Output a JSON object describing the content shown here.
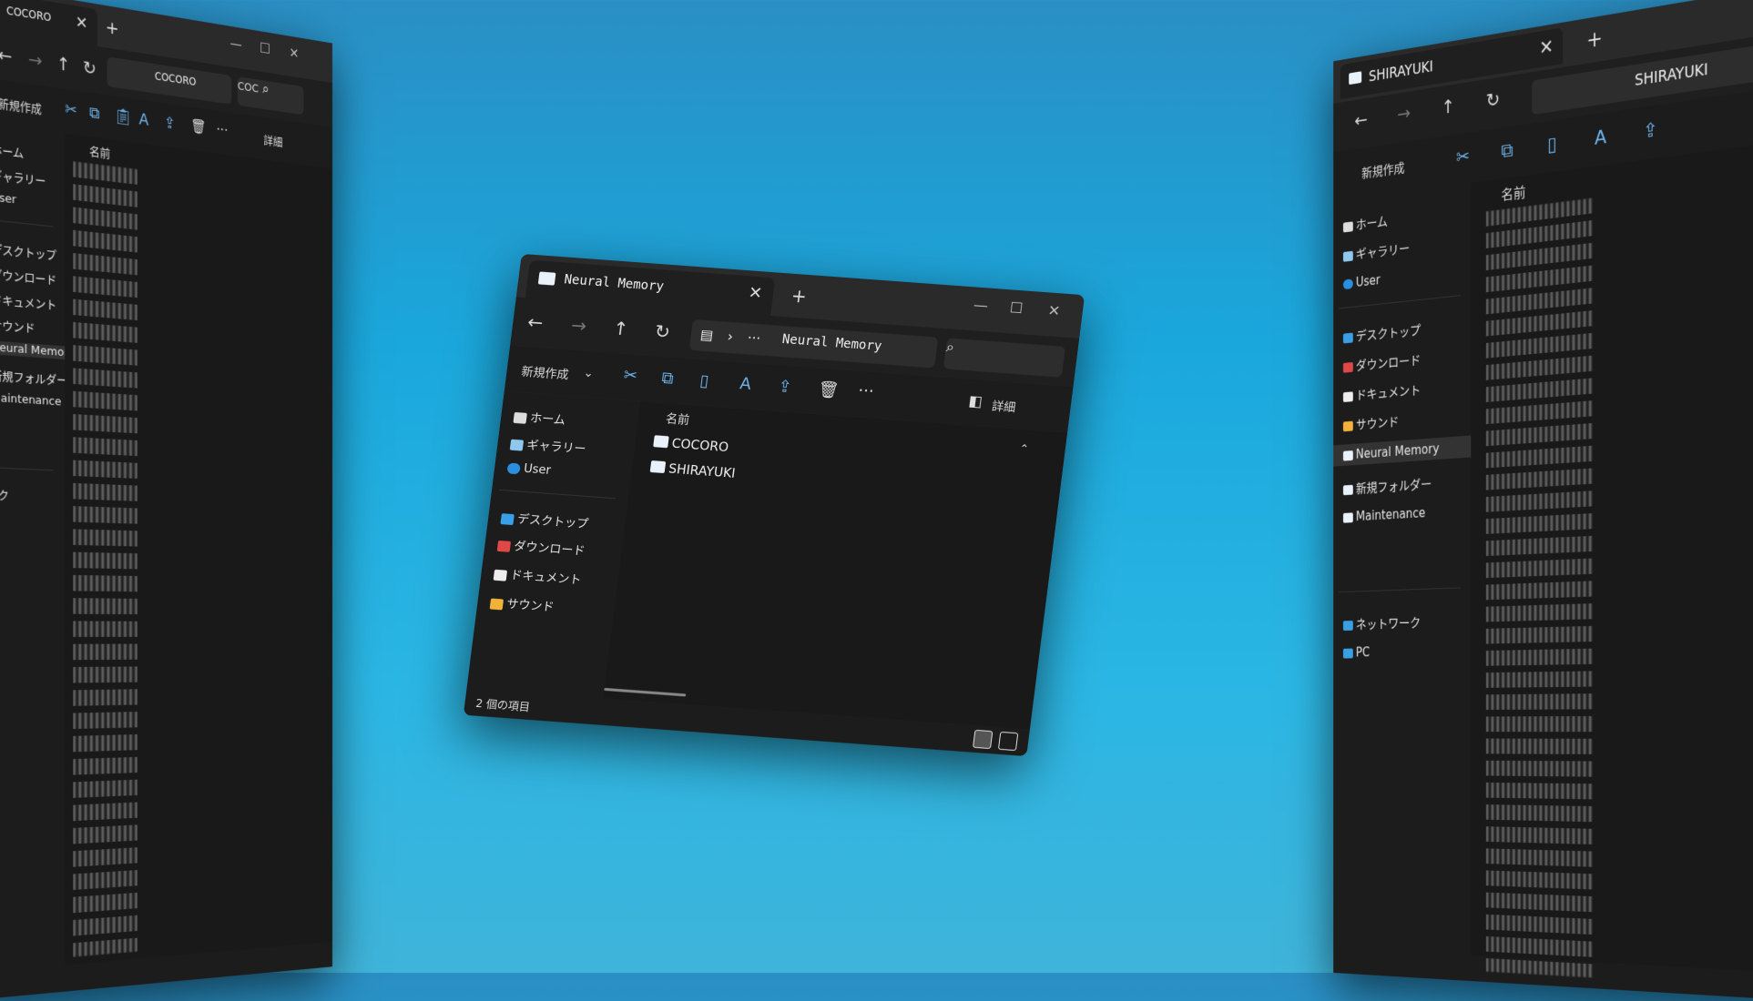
{
  "left_window": {
    "tab_title": "COCORO",
    "address": "COCORO",
    "search_text": "COC",
    "new_label": "新規作成",
    "details_label": "詳細",
    "column_name": "名前",
    "sidebar": [
      "ホーム",
      "ギャラリー",
      "User",
      "デスクトップ",
      "ダウンロード",
      "ドキュメント",
      "サウンド",
      "Neural Memory",
      "新規フォルダー",
      "Maintenance",
      "ワーク"
    ]
  },
  "main_window": {
    "tab_title": "Neural Memory",
    "address": "Neural Memory",
    "new_label": "新規作成",
    "details_label": "詳細",
    "column_name": "名前",
    "sidebar": [
      "ホーム",
      "ギャラリー",
      "User",
      "デスクトップ",
      "ダウンロード",
      "ドキュメント",
      "サウンド"
    ],
    "files": [
      "COCORO",
      "SHIRAYUKI"
    ],
    "status": "2 個の項目"
  },
  "right_window": {
    "tab_title": "SHIRAYUKI",
    "address": "SHIRAYUKI",
    "new_label": "新規作成",
    "column_name": "名前",
    "sidebar": [
      "ホーム",
      "ギャラリー",
      "User",
      "デスクトップ",
      "ダウンロード",
      "ドキュメント",
      "サウンド",
      "Neural Memory",
      "新規フォルダー",
      "Maintenance",
      "ネットワーク",
      "PC"
    ]
  },
  "colors": {
    "desktop": "#1aa7dc",
    "window_bg": "#1c1c1c",
    "accent": "#6fb6ef"
  }
}
